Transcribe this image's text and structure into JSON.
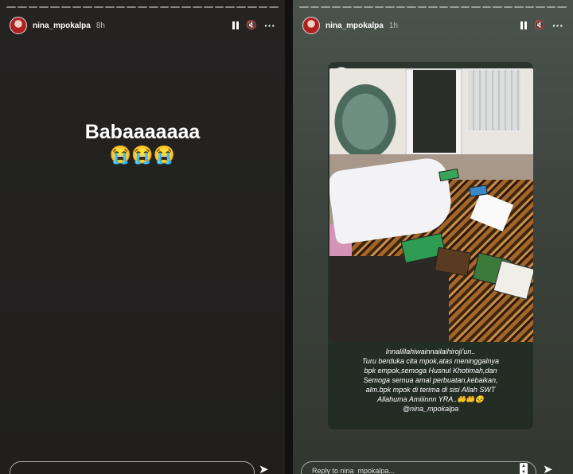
{
  "panels": [
    {
      "username": "nina_mpokalpa",
      "time": "8h",
      "story_text": "Babaaaaaaa",
      "story_emoji": "😭😭😭",
      "reply_placeholder": ""
    },
    {
      "username": "nina_mpokalpa",
      "time": "1h",
      "repost": {
        "username": "ayuceriwis09",
        "caption_lines": [
          "Innalillahiwainnailaihiroji'un..",
          "Turu berduka cita mpok,atas meninggalnya",
          "bpk empok,semoga Husnul Khotimah,dan",
          "Semoga semua amal perbuatan,kebaikan,",
          "alm.bpk mpok di terima di sisi Allah SWT",
          "Allahuma Amiiinnn YRA..🤲🤲😣",
          "@nina_mpokalpa"
        ]
      },
      "reply_placeholder": "Reply to nina_mpokalpa..."
    }
  ],
  "icons": {
    "pause": "pause-icon",
    "mute": "mute-icon",
    "more": "more-icon",
    "send": "send-icon"
  },
  "colors": {
    "panel1_bg": "#242322",
    "panel2_bg": "#3c433d",
    "text": "#ffffff"
  }
}
